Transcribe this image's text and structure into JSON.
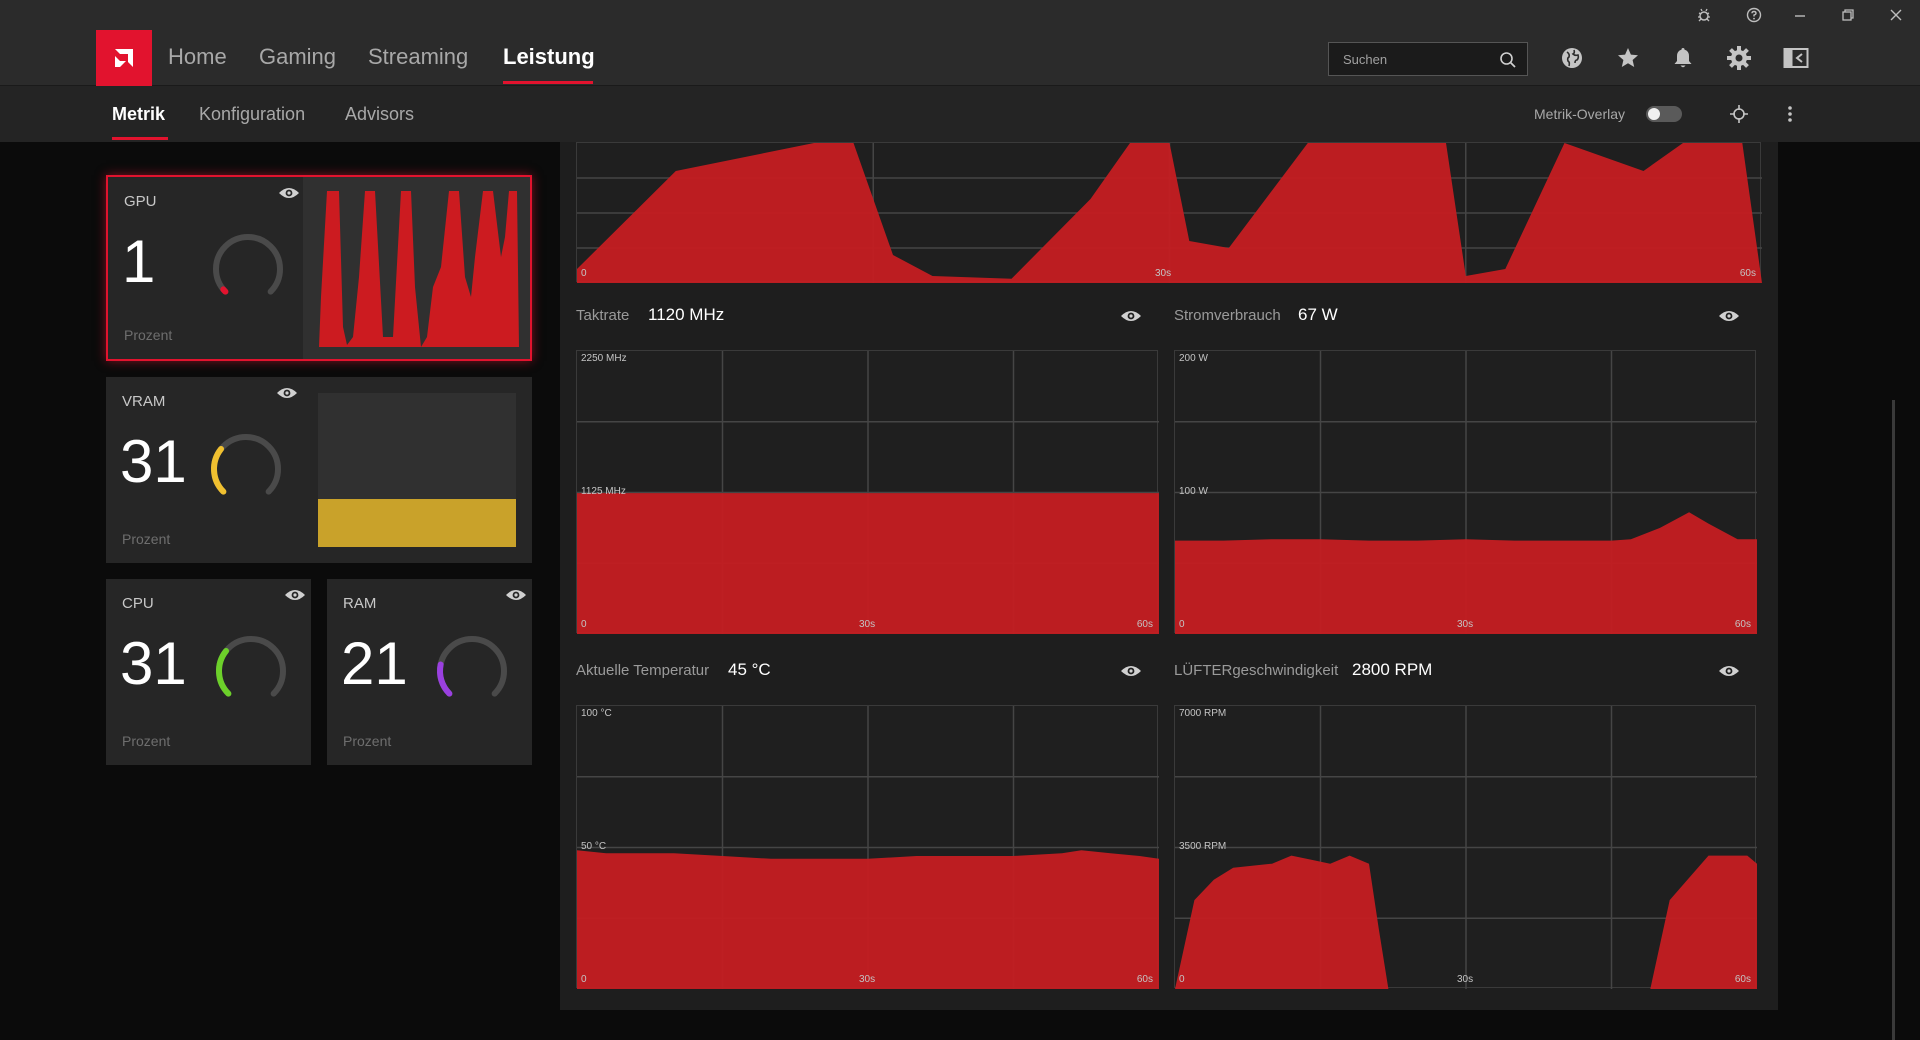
{
  "window": {
    "controls": [
      "bug-icon",
      "help-icon",
      "minimize-icon",
      "restore-icon",
      "close-icon"
    ]
  },
  "nav": {
    "tabs": [
      {
        "label": "Home"
      },
      {
        "label": "Gaming"
      },
      {
        "label": "Streaming"
      },
      {
        "label": "Leistung"
      }
    ],
    "active_tab": "Leistung",
    "search_placeholder": "Suchen",
    "icons": [
      "globe-icon",
      "star-icon",
      "bell-icon",
      "gear-icon",
      "sidebar-toggle-icon"
    ]
  },
  "subnav": {
    "tabs": [
      {
        "label": "Metrik"
      },
      {
        "label": "Konfiguration"
      },
      {
        "label": "Advisors"
      }
    ],
    "active_tab": "Metrik",
    "overlay_label": "Metrik-Overlay",
    "overlay_enabled": false
  },
  "cards": {
    "gpu": {
      "label": "GPU",
      "value": "1",
      "unit": "Prozent",
      "color": "#e2132e",
      "level": 0.01
    },
    "vram": {
      "label": "VRAM",
      "value": "31",
      "unit": "Prozent",
      "color": "#f0c030",
      "level": 0.31
    },
    "cpu": {
      "label": "CPU",
      "value": "31",
      "unit": "Prozent",
      "color": "#6cd02a",
      "level": 0.31
    },
    "ram": {
      "label": "RAM",
      "value": "21",
      "unit": "Prozent",
      "color": "#9a40e0",
      "level": 0.21
    }
  },
  "metrics": {
    "top": {
      "ymin": "0",
      "xmid": "30s",
      "xmax": "60s"
    },
    "clock": {
      "label": "Taktrate",
      "value": "1120 MHz",
      "ymax": "2250 MHz",
      "ymid": "1125 MHz",
      "ymin": "0",
      "xmid": "30s",
      "xmax": "60s"
    },
    "power": {
      "label": "Stromverbrauch",
      "value": "67 W",
      "ymax": "200 W",
      "ymid": "100 W",
      "ymin": "0",
      "xmid": "30s",
      "xmax": "60s"
    },
    "temp": {
      "label": "Aktuelle Temperatur",
      "value": "45 °C",
      "ymax": "100 °C",
      "ymid": "50 °C",
      "ymin": "0",
      "xmid": "30s",
      "xmax": "60s"
    },
    "fan": {
      "label": "LÜFTERgeschwindigkeit",
      "value": "2800 RPM",
      "ymax": "7000 RPM",
      "ymid": "3500 RPM",
      "ymin": "0",
      "xmid": "30s",
      "xmax": "60s"
    }
  },
  "chart_data": [
    {
      "type": "area",
      "name": "gpu-usage-top",
      "x": [
        0,
        5,
        12,
        14,
        16,
        18,
        22,
        26,
        28,
        29,
        30,
        31,
        33,
        37,
        39,
        44,
        45,
        47,
        50,
        54,
        56,
        59,
        60
      ],
      "values": [
        10,
        80,
        100,
        100,
        20,
        5,
        3,
        60,
        100,
        100,
        100,
        30,
        25,
        100,
        100,
        100,
        5,
        10,
        100,
        80,
        100,
        100,
        0
      ],
      "ylim": [
        0,
        100
      ]
    },
    {
      "type": "area",
      "name": "clock",
      "x": [
        0,
        60
      ],
      "values": [
        1120,
        1120
      ],
      "ylim": [
        0,
        2250
      ]
    },
    {
      "type": "area",
      "name": "power",
      "x": [
        0,
        5,
        10,
        15,
        20,
        25,
        30,
        35,
        40,
        45,
        47,
        50,
        53,
        55,
        58,
        60
      ],
      "values": [
        66,
        66,
        67,
        67,
        66,
        66,
        67,
        66,
        66,
        66,
        67,
        75,
        86,
        78,
        67,
        67
      ],
      "ylim": [
        0,
        200
      ]
    },
    {
      "type": "area",
      "name": "temp",
      "x": [
        0,
        3,
        6,
        10,
        15,
        20,
        25,
        30,
        35,
        40,
        45,
        50,
        52,
        55,
        58,
        60
      ],
      "values": [
        49,
        48,
        48,
        48,
        47,
        46,
        46,
        46,
        47,
        47,
        47,
        48,
        49,
        48,
        47,
        46
      ],
      "ylim": [
        0,
        100
      ]
    },
    {
      "type": "area",
      "name": "fan",
      "x": [
        0,
        2,
        4,
        6,
        10,
        12,
        14,
        16,
        18,
        20,
        21,
        22,
        25,
        47,
        49,
        51,
        55,
        59,
        60
      ],
      "values": [
        0,
        2200,
        2700,
        3000,
        3100,
        3300,
        3200,
        3100,
        3300,
        3100,
        1500,
        0,
        0,
        0,
        0,
        2200,
        3300,
        3300,
        3100
      ],
      "ylim": [
        0,
        7000
      ]
    }
  ]
}
